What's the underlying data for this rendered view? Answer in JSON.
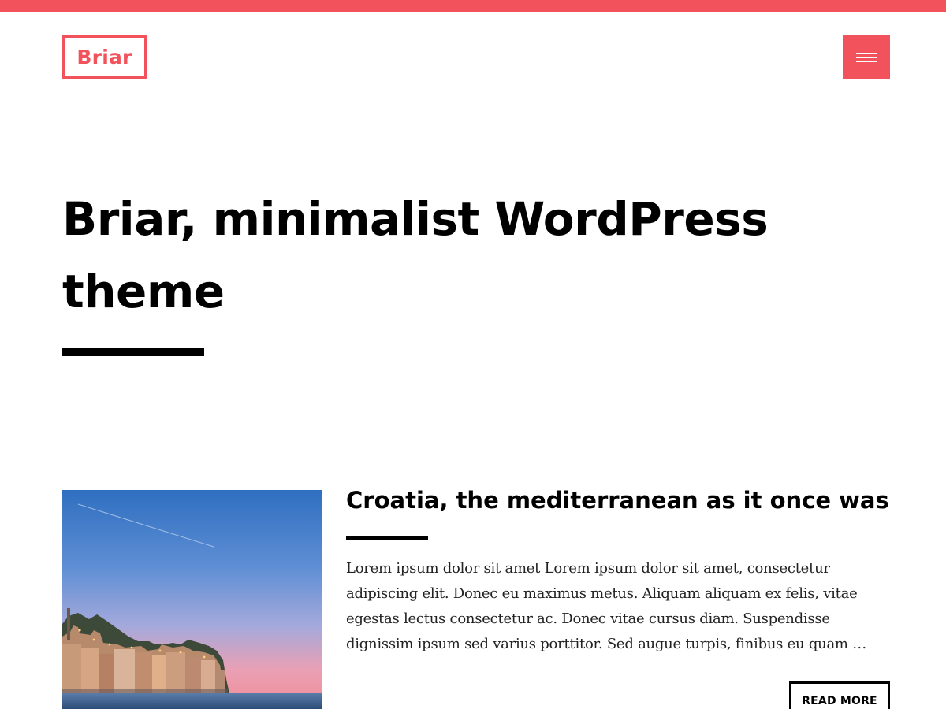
{
  "site": {
    "logo_text": "Briar",
    "accent_color": "#f2525b",
    "menu_icon": "hamburger-icon"
  },
  "hero": {
    "title": "Briar, minimalist WordPress theme"
  },
  "posts": [
    {
      "title": "Croatia, the mediterranean as it once was",
      "excerpt": "Lorem ipsum dolor sit amet Lorem ipsum dolor sit amet, consectetur adipiscing elit. Donec eu maximus metus. Aliquam aliquam ex felis, vitae egestas lectus consectetur ac. Donec vitae cursus diam. Suspendisse dignissim ipsum sed varius porttitor. Sed augue turpis, finibus eu quam …",
      "read_more_label": "READ MORE",
      "thumbnail_icon": "coastal-town-image"
    }
  ]
}
